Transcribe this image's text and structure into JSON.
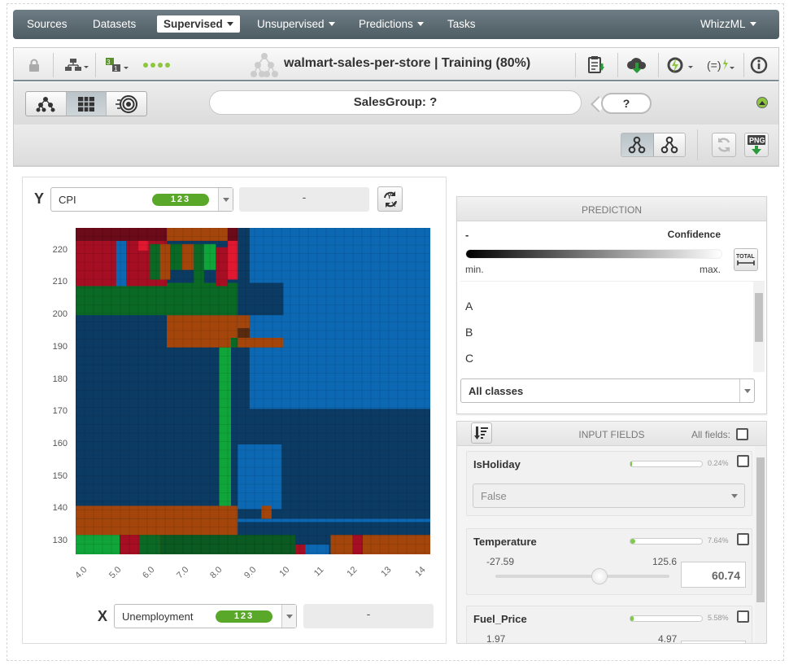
{
  "nav": {
    "items": [
      "Sources",
      "Datasets",
      "Supervised",
      "Unsupervised",
      "Predictions",
      "Tasks"
    ],
    "active": "Supervised",
    "right": "WhizzML"
  },
  "toolbar": {
    "title": "walmart-sales-per-store | Training (80%)"
  },
  "path": {
    "text": "SalesGroup: ?",
    "prediction": "?"
  },
  "y_axis": {
    "axis_letter": "Y",
    "field": "CPI",
    "type_badge": "123",
    "value": "-"
  },
  "x_axis": {
    "axis_letter": "X",
    "field": "Unemployment",
    "type_badge": "123",
    "value": "-"
  },
  "chart_data": {
    "type": "heatmap",
    "x_ticks": [
      "4.0",
      "5.0",
      "6.0",
      "7.0",
      "8.0",
      "9.0",
      "10",
      "11",
      "12",
      "13",
      "14"
    ],
    "y_ticks": [
      "220",
      "210",
      "200",
      "190",
      "180",
      "170",
      "160",
      "150",
      "140",
      "130"
    ],
    "xlim": [
      3.8,
      14.3
    ],
    "ylim": [
      126,
      227
    ],
    "class_colors": {
      "A_dark": "#0b3b63",
      "A_light": "#0c68b3",
      "B_dark": "#0a6a25",
      "B_light": "#10a53a",
      "C_dark": "#a50e23",
      "C_orange": "#a4460b"
    },
    "regions": [
      {
        "x": [
          3.8,
          14.3
        ],
        "y": [
          126,
          227
        ],
        "c": "#0b3b63"
      },
      {
        "x": [
          8.95,
          14.3
        ],
        "y": [
          171,
          227
        ],
        "c": "#0c68b3"
      },
      {
        "x": [
          8.6,
          14.3
        ],
        "y": [
          134,
          137
        ],
        "c": "#0c68b3"
      },
      {
        "x": [
          8.6,
          9.9
        ],
        "y": [
          140,
          160
        ],
        "c": "#0c68b3"
      },
      {
        "x": [
          3.8,
          8.6
        ],
        "y": [
          126,
          137
        ],
        "c": "#a4460b"
      },
      {
        "x": [
          3.8,
          8.6
        ],
        "y": [
          137,
          141
        ],
        "c": "#a4460b"
      },
      {
        "x": [
          9.3,
          9.6
        ],
        "y": [
          137,
          141
        ],
        "c": "#a4460b"
      },
      {
        "x": [
          8.6,
          14.3
        ],
        "y": [
          126,
          136
        ],
        "c": "#0b3b63"
      },
      {
        "x": [
          6.5,
          8.6
        ],
        "y": [
          190,
          200
        ],
        "c": "#a4460b"
      },
      {
        "x": [
          8.6,
          9.95
        ],
        "y": [
          190,
          193
        ],
        "c": "#a4460b"
      },
      {
        "x": [
          8.6,
          8.95
        ],
        "y": [
          193,
          196
        ],
        "c": "#5a2a0e"
      },
      {
        "x": [
          8.6,
          8.95
        ],
        "y": [
          196,
          200
        ],
        "c": "#a4460b"
      },
      {
        "x": [
          8.6,
          9.95
        ],
        "y": [
          200,
          210
        ],
        "c": "#0b3b63"
      },
      {
        "x": [
          8.05,
          8.4
        ],
        "y": [
          141,
          190
        ],
        "c": "#10a53a"
      },
      {
        "x": [
          8.4,
          8.6
        ],
        "y": [
          190,
          193
        ],
        "c": "#0a6a25"
      },
      {
        "x": [
          3.8,
          8.6
        ],
        "y": [
          200,
          210
        ],
        "c": "#0a6a25"
      },
      {
        "x": [
          3.8,
          5.0
        ],
        "y": [
          209,
          223
        ],
        "c": "#a50e23"
      },
      {
        "x": [
          5.0,
          5.3
        ],
        "y": [
          209,
          223
        ],
        "c": "#0c68b3"
      },
      {
        "x": [
          5.3,
          6.5
        ],
        "y": [
          209,
          223
        ],
        "c": "#a50e23"
      },
      {
        "x": [
          5.65,
          5.95
        ],
        "y": [
          220,
          227
        ],
        "c": "#e01830"
      },
      {
        "x": [
          6.0,
          6.3
        ],
        "y": [
          211,
          222
        ],
        "c": "#0a6a25"
      },
      {
        "x": [
          6.3,
          6.6
        ],
        "y": [
          211,
          222
        ],
        "c": "#a4460b"
      },
      {
        "x": [
          6.6,
          6.95
        ],
        "y": [
          214,
          222
        ],
        "c": "#0a6a25"
      },
      {
        "x": [
          6.95,
          7.3
        ],
        "y": [
          214,
          222
        ],
        "c": "#a4460b"
      },
      {
        "x": [
          7.3,
          7.6
        ],
        "y": [
          209,
          222
        ],
        "c": "#0a6a25"
      },
      {
        "x": [
          7.6,
          7.95
        ],
        "y": [
          214,
          222
        ],
        "c": "#10a53a"
      },
      {
        "x": [
          7.95,
          8.3
        ],
        "y": [
          209,
          221
        ],
        "c": "#a50e23"
      },
      {
        "x": [
          8.3,
          8.6
        ],
        "y": [
          211,
          227
        ],
        "c": "#e01830"
      },
      {
        "x": [
          3.8,
          8.6
        ],
        "y": [
          223,
          227
        ],
        "c": "#6b0a18"
      },
      {
        "x": [
          6.5,
          8.3
        ],
        "y": [
          223,
          227
        ],
        "c": "#a4460b"
      },
      {
        "x": [
          3.8,
          5.1
        ],
        "y": [
          126,
          132
        ],
        "c": "#10a53a"
      },
      {
        "x": [
          5.1,
          5.7
        ],
        "y": [
          126,
          132
        ],
        "c": "#a50e23"
      },
      {
        "x": [
          5.7,
          6.3
        ],
        "y": [
          126,
          132
        ],
        "c": "#0a6a25"
      },
      {
        "x": [
          6.3,
          10.3
        ],
        "y": [
          126,
          132
        ],
        "c": "#0a5a22"
      },
      {
        "x": [
          10.3,
          10.6
        ],
        "y": [
          126,
          129
        ],
        "c": "#a50e23"
      },
      {
        "x": [
          11.35,
          12.0
        ],
        "y": [
          126,
          132
        ],
        "c": "#a4460b"
      },
      {
        "x": [
          12.0,
          12.3
        ],
        "y": [
          126,
          132
        ],
        "c": "#a50e23"
      },
      {
        "x": [
          12.3,
          14.3
        ],
        "y": [
          126,
          132
        ],
        "c": "#a4460b"
      },
      {
        "x": [
          10.6,
          11.3
        ],
        "y": [
          126,
          129
        ],
        "c": "#0c68b3"
      }
    ]
  },
  "prediction_panel": {
    "title": "PREDICTION",
    "value": "-",
    "confidence_label": "Confidence",
    "min_label": "min.",
    "max_label": "max.",
    "total_icon": "TOTAL",
    "classes": [
      "A",
      "B",
      "C"
    ],
    "filter": "All classes"
  },
  "inputs_panel": {
    "title": "INPUT FIELDS",
    "all_fields_label": "All fields:",
    "fields": [
      {
        "name": "IsHoliday",
        "importance": "0.24%",
        "importance_frac": 0.0024,
        "select_value": "False"
      },
      {
        "name": "Temperature",
        "importance": "7.64%",
        "importance_frac": 0.0764,
        "min": "-27.59",
        "max": "125.6",
        "value": "60.74",
        "slider_frac": 0.6
      },
      {
        "name": "Fuel_Price",
        "importance": "5.58%",
        "importance_frac": 0.0558,
        "min": "1.97",
        "max": "4.97"
      }
    ]
  }
}
